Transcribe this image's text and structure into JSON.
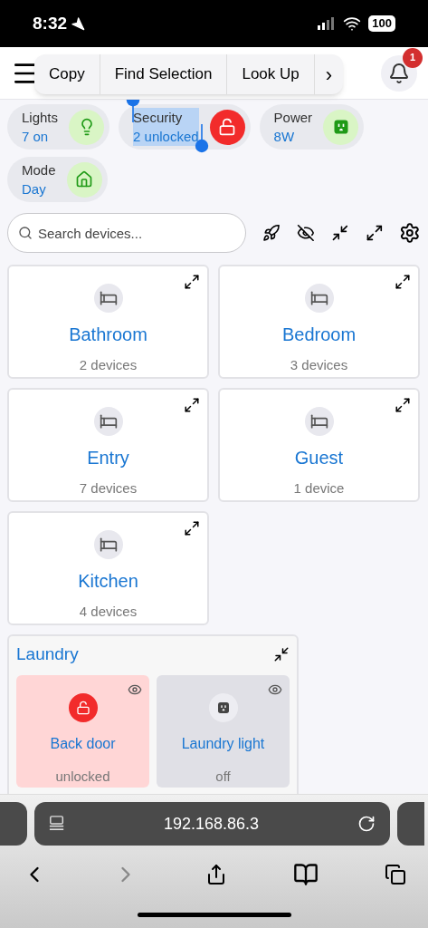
{
  "status_bar": {
    "time": "8:32",
    "battery": "100"
  },
  "header": {
    "notifications": "1"
  },
  "context_menu": {
    "items": [
      "Copy",
      "Find Selection",
      "Look Up"
    ],
    "more": "›"
  },
  "summary": [
    {
      "kind": "light",
      "label": "Lights",
      "value": "7 on",
      "alert": false,
      "selected": false
    },
    {
      "kind": "lock",
      "label": "Security",
      "value": "2 unlocked",
      "alert": true,
      "selected": true
    },
    {
      "kind": "outlet",
      "label": "Power",
      "value": "8W",
      "alert": false,
      "selected": false
    },
    {
      "kind": "mode",
      "label": "Mode",
      "value": "Day",
      "alert": false,
      "selected": false
    }
  ],
  "search": {
    "placeholder": "Search devices..."
  },
  "rooms": [
    {
      "name": "Bathroom",
      "count": "2 devices"
    },
    {
      "name": "Bedroom",
      "count": "3 devices"
    },
    {
      "name": "Entry",
      "count": "7 devices"
    },
    {
      "name": "Guest",
      "count": "1 device"
    },
    {
      "name": "Kitchen",
      "count": "4 devices"
    }
  ],
  "open_room": {
    "name": "Laundry",
    "devices": [
      {
        "kind": "lock",
        "name": "Back door",
        "status": "unlocked",
        "alert": true
      },
      {
        "kind": "outlet",
        "name": "Laundry light",
        "status": "off",
        "alert": false
      }
    ]
  },
  "browser": {
    "address": "192.168.86.3"
  }
}
